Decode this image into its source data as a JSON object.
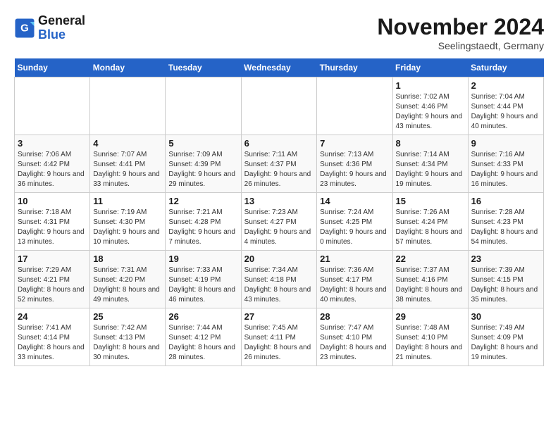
{
  "header": {
    "logo_line1": "General",
    "logo_line2": "Blue",
    "month": "November 2024",
    "location": "Seelingstaedt, Germany"
  },
  "weekdays": [
    "Sunday",
    "Monday",
    "Tuesday",
    "Wednesday",
    "Thursday",
    "Friday",
    "Saturday"
  ],
  "weeks": [
    [
      {
        "day": "",
        "sunrise": "",
        "sunset": "",
        "daylight": ""
      },
      {
        "day": "",
        "sunrise": "",
        "sunset": "",
        "daylight": ""
      },
      {
        "day": "",
        "sunrise": "",
        "sunset": "",
        "daylight": ""
      },
      {
        "day": "",
        "sunrise": "",
        "sunset": "",
        "daylight": ""
      },
      {
        "day": "",
        "sunrise": "",
        "sunset": "",
        "daylight": ""
      },
      {
        "day": "1",
        "sunrise": "Sunrise: 7:02 AM",
        "sunset": "Sunset: 4:46 PM",
        "daylight": "Daylight: 9 hours and 43 minutes."
      },
      {
        "day": "2",
        "sunrise": "Sunrise: 7:04 AM",
        "sunset": "Sunset: 4:44 PM",
        "daylight": "Daylight: 9 hours and 40 minutes."
      }
    ],
    [
      {
        "day": "3",
        "sunrise": "Sunrise: 7:06 AM",
        "sunset": "Sunset: 4:42 PM",
        "daylight": "Daylight: 9 hours and 36 minutes."
      },
      {
        "day": "4",
        "sunrise": "Sunrise: 7:07 AM",
        "sunset": "Sunset: 4:41 PM",
        "daylight": "Daylight: 9 hours and 33 minutes."
      },
      {
        "day": "5",
        "sunrise": "Sunrise: 7:09 AM",
        "sunset": "Sunset: 4:39 PM",
        "daylight": "Daylight: 9 hours and 29 minutes."
      },
      {
        "day": "6",
        "sunrise": "Sunrise: 7:11 AM",
        "sunset": "Sunset: 4:37 PM",
        "daylight": "Daylight: 9 hours and 26 minutes."
      },
      {
        "day": "7",
        "sunrise": "Sunrise: 7:13 AM",
        "sunset": "Sunset: 4:36 PM",
        "daylight": "Daylight: 9 hours and 23 minutes."
      },
      {
        "day": "8",
        "sunrise": "Sunrise: 7:14 AM",
        "sunset": "Sunset: 4:34 PM",
        "daylight": "Daylight: 9 hours and 19 minutes."
      },
      {
        "day": "9",
        "sunrise": "Sunrise: 7:16 AM",
        "sunset": "Sunset: 4:33 PM",
        "daylight": "Daylight: 9 hours and 16 minutes."
      }
    ],
    [
      {
        "day": "10",
        "sunrise": "Sunrise: 7:18 AM",
        "sunset": "Sunset: 4:31 PM",
        "daylight": "Daylight: 9 hours and 13 minutes."
      },
      {
        "day": "11",
        "sunrise": "Sunrise: 7:19 AM",
        "sunset": "Sunset: 4:30 PM",
        "daylight": "Daylight: 9 hours and 10 minutes."
      },
      {
        "day": "12",
        "sunrise": "Sunrise: 7:21 AM",
        "sunset": "Sunset: 4:28 PM",
        "daylight": "Daylight: 9 hours and 7 minutes."
      },
      {
        "day": "13",
        "sunrise": "Sunrise: 7:23 AM",
        "sunset": "Sunset: 4:27 PM",
        "daylight": "Daylight: 9 hours and 4 minutes."
      },
      {
        "day": "14",
        "sunrise": "Sunrise: 7:24 AM",
        "sunset": "Sunset: 4:25 PM",
        "daylight": "Daylight: 9 hours and 0 minutes."
      },
      {
        "day": "15",
        "sunrise": "Sunrise: 7:26 AM",
        "sunset": "Sunset: 4:24 PM",
        "daylight": "Daylight: 8 hours and 57 minutes."
      },
      {
        "day": "16",
        "sunrise": "Sunrise: 7:28 AM",
        "sunset": "Sunset: 4:23 PM",
        "daylight": "Daylight: 8 hours and 54 minutes."
      }
    ],
    [
      {
        "day": "17",
        "sunrise": "Sunrise: 7:29 AM",
        "sunset": "Sunset: 4:21 PM",
        "daylight": "Daylight: 8 hours and 52 minutes."
      },
      {
        "day": "18",
        "sunrise": "Sunrise: 7:31 AM",
        "sunset": "Sunset: 4:20 PM",
        "daylight": "Daylight: 8 hours and 49 minutes."
      },
      {
        "day": "19",
        "sunrise": "Sunrise: 7:33 AM",
        "sunset": "Sunset: 4:19 PM",
        "daylight": "Daylight: 8 hours and 46 minutes."
      },
      {
        "day": "20",
        "sunrise": "Sunrise: 7:34 AM",
        "sunset": "Sunset: 4:18 PM",
        "daylight": "Daylight: 8 hours and 43 minutes."
      },
      {
        "day": "21",
        "sunrise": "Sunrise: 7:36 AM",
        "sunset": "Sunset: 4:17 PM",
        "daylight": "Daylight: 8 hours and 40 minutes."
      },
      {
        "day": "22",
        "sunrise": "Sunrise: 7:37 AM",
        "sunset": "Sunset: 4:16 PM",
        "daylight": "Daylight: 8 hours and 38 minutes."
      },
      {
        "day": "23",
        "sunrise": "Sunrise: 7:39 AM",
        "sunset": "Sunset: 4:15 PM",
        "daylight": "Daylight: 8 hours and 35 minutes."
      }
    ],
    [
      {
        "day": "24",
        "sunrise": "Sunrise: 7:41 AM",
        "sunset": "Sunset: 4:14 PM",
        "daylight": "Daylight: 8 hours and 33 minutes."
      },
      {
        "day": "25",
        "sunrise": "Sunrise: 7:42 AM",
        "sunset": "Sunset: 4:13 PM",
        "daylight": "Daylight: 8 hours and 30 minutes."
      },
      {
        "day": "26",
        "sunrise": "Sunrise: 7:44 AM",
        "sunset": "Sunset: 4:12 PM",
        "daylight": "Daylight: 8 hours and 28 minutes."
      },
      {
        "day": "27",
        "sunrise": "Sunrise: 7:45 AM",
        "sunset": "Sunset: 4:11 PM",
        "daylight": "Daylight: 8 hours and 26 minutes."
      },
      {
        "day": "28",
        "sunrise": "Sunrise: 7:47 AM",
        "sunset": "Sunset: 4:10 PM",
        "daylight": "Daylight: 8 hours and 23 minutes."
      },
      {
        "day": "29",
        "sunrise": "Sunrise: 7:48 AM",
        "sunset": "Sunset: 4:10 PM",
        "daylight": "Daylight: 8 hours and 21 minutes."
      },
      {
        "day": "30",
        "sunrise": "Sunrise: 7:49 AM",
        "sunset": "Sunset: 4:09 PM",
        "daylight": "Daylight: 8 hours and 19 minutes."
      }
    ]
  ]
}
